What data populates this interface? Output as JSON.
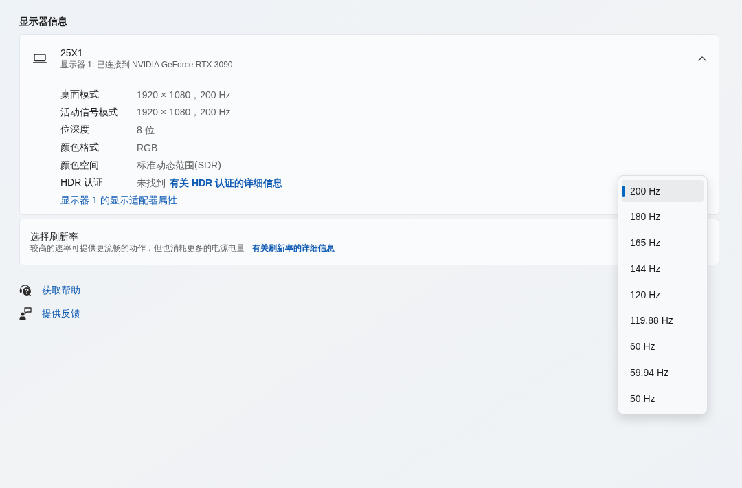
{
  "section_title": "显示器信息",
  "display_card": {
    "expanded": true,
    "name": "25X1",
    "subtitle": "显示器 1: 已连接到 NVIDIA GeForce RTX 3090",
    "properties": [
      {
        "label": "桌面模式",
        "value": "1920 × 1080，200 Hz"
      },
      {
        "label": "活动信号模式",
        "value": "1920 × 1080，200 Hz"
      },
      {
        "label": "位深度",
        "value": "8 位"
      },
      {
        "label": "颜色格式",
        "value": "RGB"
      },
      {
        "label": "颜色空间",
        "value": "标准动态范围(SDR)"
      },
      {
        "label": "HDR 认证",
        "value": "未找到",
        "link": "有关 HDR 认证的详细信息"
      }
    ],
    "adapter_link": "显示器 1 的显示适配器属性"
  },
  "refresh_rate": {
    "title": "选择刷新率",
    "description": "较高的速率可提供更流畅的动作，但也消耗更多的电源电量",
    "link": "有关刷新率的详细信息",
    "options": [
      {
        "label": "200 Hz",
        "selected": true
      },
      {
        "label": "180 Hz",
        "selected": false
      },
      {
        "label": "165 Hz",
        "selected": false
      },
      {
        "label": "144 Hz",
        "selected": false
      },
      {
        "label": "120 Hz",
        "selected": false
      },
      {
        "label": "119.88 Hz",
        "selected": false
      },
      {
        "label": "60 Hz",
        "selected": false
      },
      {
        "label": "59.94 Hz",
        "selected": false
      },
      {
        "label": "50 Hz",
        "selected": false
      }
    ]
  },
  "help_links": [
    {
      "kind": "help",
      "label": "获取帮助"
    },
    {
      "kind": "feedback",
      "label": "提供反馈"
    }
  ]
}
